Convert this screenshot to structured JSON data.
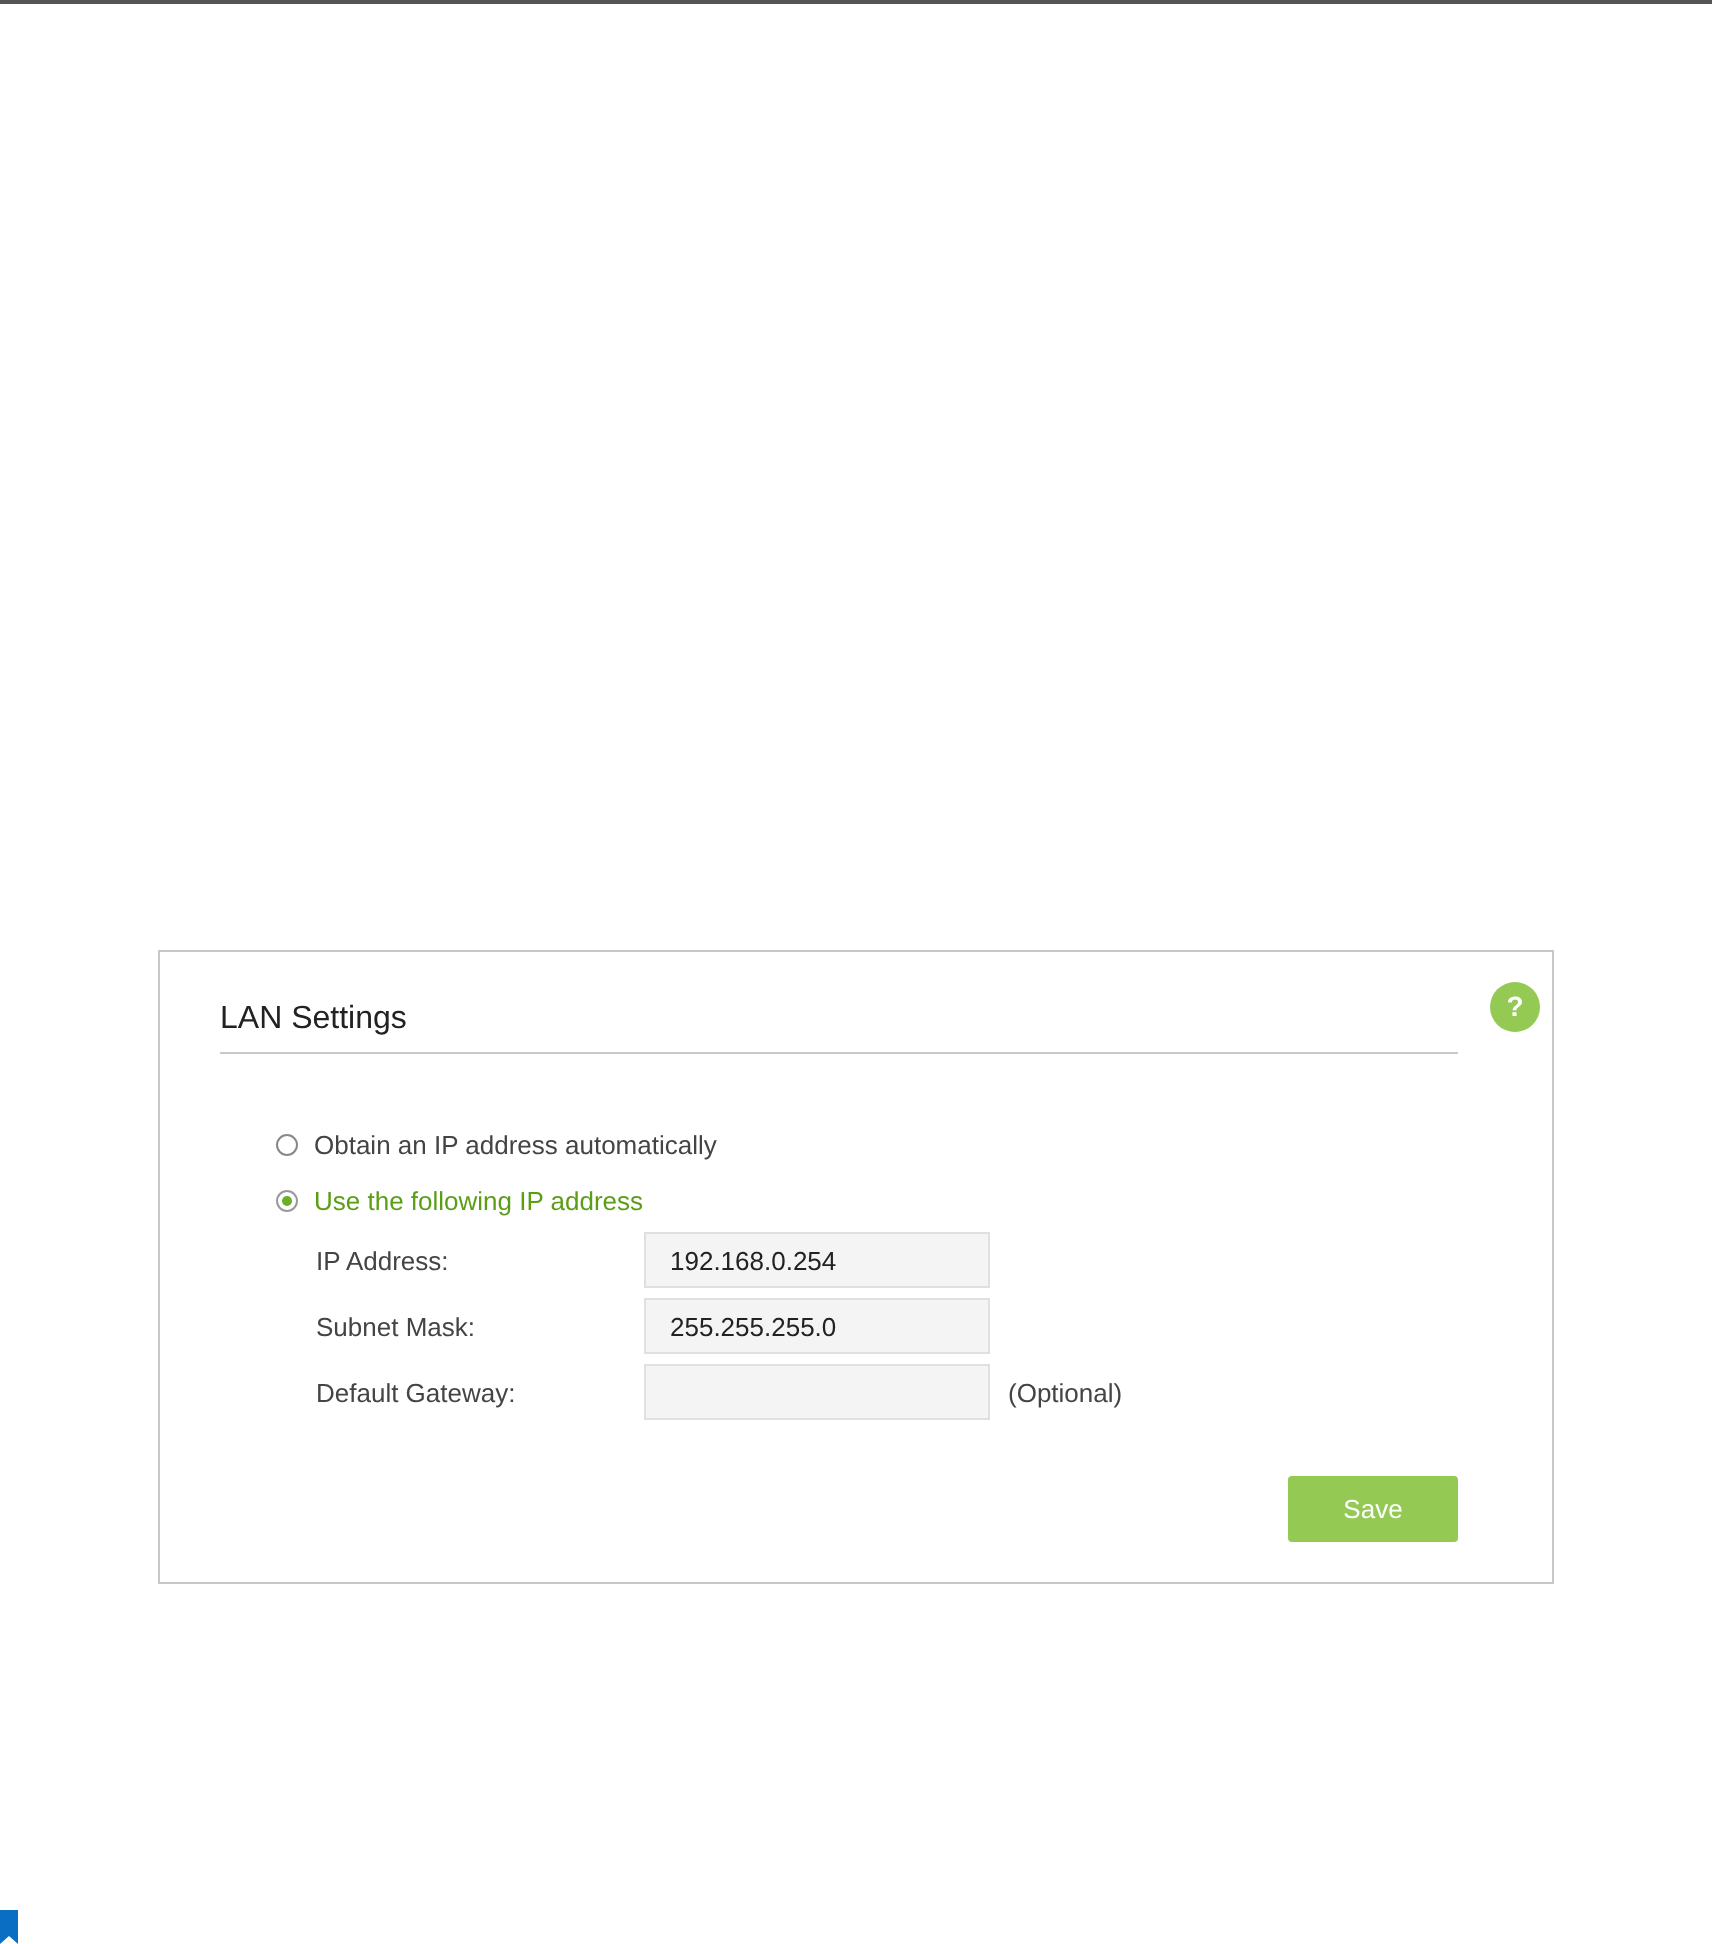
{
  "panel": {
    "title": "LAN Settings",
    "help_button": {
      "label": "?"
    }
  },
  "ip_mode_options": [
    {
      "label": "Obtain an IP address automatically",
      "selected": false
    },
    {
      "label": "Use the following IP address",
      "selected": true
    }
  ],
  "fields": [
    {
      "label": "IP Address:",
      "value": "192.168.0.254"
    },
    {
      "label": "Subnet Mask:",
      "value": "255.255.255.0"
    },
    {
      "label": "Default Gateway:",
      "note": "(Optional)"
    }
  ],
  "save_button": {
    "label": "Save"
  }
}
